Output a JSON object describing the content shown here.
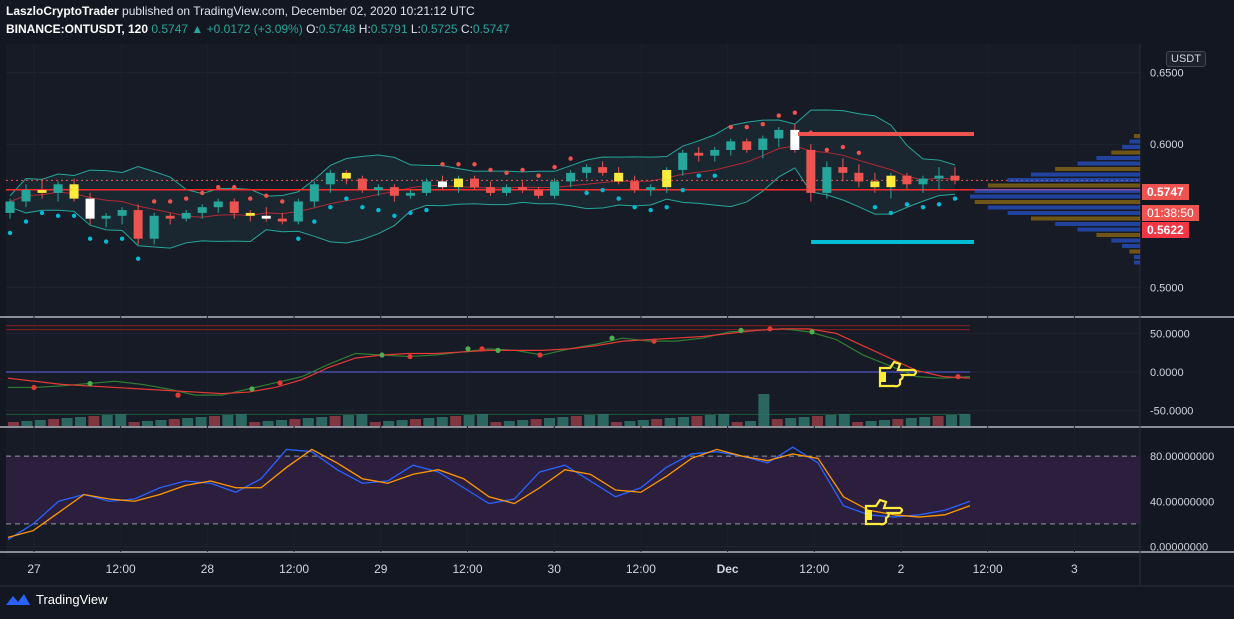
{
  "header": {
    "author": "LaszloCryptoTrader",
    "published": "published on TradingView.com, December 02, 2020 10:21:12 UTC",
    "symbol": "BINANCE:ONTUSDT, 120",
    "last": "0.5747",
    "change": "+0.0172 (+3.09%)",
    "o_label": "O:",
    "o": "0.5748",
    "h_label": "H:",
    "h": "0.5791",
    "l_label": "L:",
    "l": "0.5725",
    "c_label": "C:",
    "c": "0.5747"
  },
  "currency": "USDT",
  "tags": {
    "price": "0.5747",
    "countdown": "01:38:50",
    "level": "0.5622"
  },
  "footer": {
    "brand": "TradingView"
  },
  "colors": {
    "up": "#26a69a",
    "down": "#ef5350",
    "cyan": "#00bcd4",
    "yellow": "#ffeb3b",
    "bg": "#131722"
  },
  "chart_data": [
    {
      "type": "candlestick",
      "name": "price",
      "ylim": [
        0.48,
        0.67
      ],
      "yticks": [
        "0.6500",
        "0.6000",
        "0.5000"
      ],
      "ytick_values": [
        0.65,
        0.6,
        0.5
      ],
      "xticks": [
        "27",
        "12:00",
        "28",
        "12:00",
        "29",
        "12:00",
        "30",
        "12:00",
        "Dec",
        "12:00",
        "2",
        "12:00",
        "3"
      ],
      "candles": [
        [
          0.552,
          0.562,
          0.548,
          0.56
        ],
        [
          0.56,
          0.572,
          0.556,
          0.568
        ],
        [
          0.568,
          0.576,
          0.562,
          0.566
        ],
        [
          0.566,
          0.574,
          0.56,
          0.572
        ],
        [
          0.572,
          0.576,
          0.56,
          0.562
        ],
        [
          0.562,
          0.566,
          0.544,
          0.548
        ],
        [
          0.548,
          0.552,
          0.542,
          0.55
        ],
        [
          0.55,
          0.556,
          0.544,
          0.554
        ],
        [
          0.554,
          0.558,
          0.53,
          0.534
        ],
        [
          0.534,
          0.552,
          0.53,
          0.55
        ],
        [
          0.55,
          0.552,
          0.544,
          0.548
        ],
        [
          0.548,
          0.554,
          0.546,
          0.552
        ],
        [
          0.552,
          0.558,
          0.548,
          0.556
        ],
        [
          0.556,
          0.562,
          0.552,
          0.56
        ],
        [
          0.56,
          0.562,
          0.548,
          0.552
        ],
        [
          0.552,
          0.554,
          0.546,
          0.55
        ],
        [
          0.55,
          0.556,
          0.546,
          0.548
        ],
        [
          0.548,
          0.552,
          0.544,
          0.546
        ],
        [
          0.546,
          0.562,
          0.544,
          0.56
        ],
        [
          0.56,
          0.574,
          0.556,
          0.572
        ],
        [
          0.572,
          0.582,
          0.566,
          0.58
        ],
        [
          0.58,
          0.582,
          0.572,
          0.576
        ],
        [
          0.576,
          0.578,
          0.566,
          0.568
        ],
        [
          0.568,
          0.572,
          0.564,
          0.57
        ],
        [
          0.57,
          0.572,
          0.56,
          0.564
        ],
        [
          0.564,
          0.568,
          0.562,
          0.566
        ],
        [
          0.566,
          0.576,
          0.564,
          0.574
        ],
        [
          0.574,
          0.578,
          0.568,
          0.57
        ],
        [
          0.57,
          0.578,
          0.566,
          0.576
        ],
        [
          0.576,
          0.578,
          0.568,
          0.57
        ],
        [
          0.57,
          0.574,
          0.564,
          0.566
        ],
        [
          0.566,
          0.572,
          0.564,
          0.57
        ],
        [
          0.57,
          0.574,
          0.566,
          0.568
        ],
        [
          0.568,
          0.57,
          0.562,
          0.564
        ],
        [
          0.564,
          0.576,
          0.562,
          0.574
        ],
        [
          0.574,
          0.582,
          0.57,
          0.58
        ],
        [
          0.58,
          0.586,
          0.576,
          0.584
        ],
        [
          0.584,
          0.588,
          0.578,
          0.58
        ],
        [
          0.58,
          0.584,
          0.572,
          0.574
        ],
        [
          0.574,
          0.578,
          0.566,
          0.568
        ],
        [
          0.568,
          0.572,
          0.564,
          0.57
        ],
        [
          0.57,
          0.584,
          0.566,
          0.582
        ],
        [
          0.582,
          0.596,
          0.578,
          0.594
        ],
        [
          0.594,
          0.598,
          0.588,
          0.592
        ],
        [
          0.592,
          0.598,
          0.588,
          0.596
        ],
        [
          0.596,
          0.604,
          0.592,
          0.602
        ],
        [
          0.602,
          0.604,
          0.594,
          0.596
        ],
        [
          0.596,
          0.606,
          0.59,
          0.604
        ],
        [
          0.604,
          0.612,
          0.598,
          0.61
        ],
        [
          0.61,
          0.614,
          0.594,
          0.596
        ],
        [
          0.596,
          0.6,
          0.56,
          0.566
        ],
        [
          0.566,
          0.588,
          0.562,
          0.584
        ],
        [
          0.584,
          0.59,
          0.574,
          0.58
        ],
        [
          0.58,
          0.586,
          0.57,
          0.574
        ],
        [
          0.574,
          0.58,
          0.566,
          0.57
        ],
        [
          0.57,
          0.58,
          0.562,
          0.578
        ],
        [
          0.578,
          0.58,
          0.568,
          0.572
        ],
        [
          0.572,
          0.578,
          0.566,
          0.576
        ],
        [
          0.576,
          0.584,
          0.568,
          0.578
        ],
        [
          0.578,
          0.584,
          0.572,
          0.5747
        ]
      ]
    },
    {
      "type": "line",
      "name": "oscillator",
      "ylim": [
        -70,
        70
      ],
      "yticks": [
        "50.0000",
        "0.0000",
        "-50.0000"
      ],
      "ytick_values": [
        50,
        0,
        -50
      ],
      "series": [
        {
          "values": [
            -20,
            -20,
            -18,
            -15,
            -12,
            -16,
            -22,
            -30,
            -30,
            -22,
            -14,
            -6,
            10,
            24,
            22,
            20,
            22,
            26,
            30,
            28,
            22,
            30,
            36,
            44,
            40,
            40,
            44,
            52,
            54,
            56,
            52,
            42,
            22,
            8,
            -6,
            -8,
            -6
          ]
        },
        {
          "values": [
            -8,
            -12,
            -16,
            -18,
            -20,
            -22,
            -24,
            -26,
            -28,
            -26,
            -20,
            -10,
            6,
            18,
            22,
            24,
            24,
            26,
            28,
            28,
            28,
            30,
            34,
            40,
            42,
            44,
            46,
            50,
            54,
            56,
            56,
            50,
            34,
            18,
            2,
            -6,
            -8
          ]
        }
      ]
    },
    {
      "type": "line",
      "name": "stochastic",
      "ylim": [
        -5,
        105
      ],
      "yticks": [
        "80.00000000",
        "40.00000000",
        "0.00000000"
      ],
      "ytick_values": [
        80,
        40,
        0
      ],
      "bands": [
        80,
        20
      ],
      "series": [
        {
          "values": [
            6,
            20,
            40,
            46,
            40,
            42,
            52,
            58,
            56,
            48,
            60,
            86,
            84,
            68,
            56,
            58,
            72,
            66,
            52,
            38,
            42,
            66,
            72,
            58,
            44,
            52,
            70,
            82,
            84,
            80,
            74,
            88,
            74,
            36,
            28,
            26,
            28,
            32,
            40
          ]
        },
        {
          "values": [
            8,
            14,
            30,
            46,
            42,
            40,
            46,
            54,
            58,
            52,
            52,
            70,
            86,
            74,
            60,
            56,
            64,
            68,
            60,
            44,
            38,
            52,
            68,
            64,
            50,
            48,
            62,
            78,
            86,
            80,
            76,
            82,
            78,
            44,
            32,
            28,
            26,
            28,
            36
          ]
        }
      ]
    }
  ]
}
